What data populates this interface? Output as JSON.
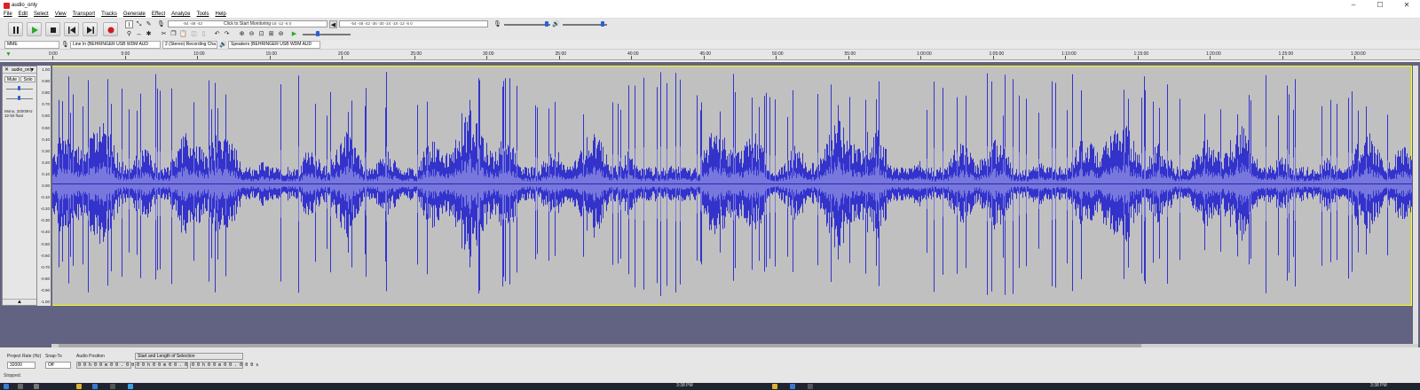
{
  "window": {
    "title": "audio_only"
  },
  "menu": [
    "File",
    "Edit",
    "Select",
    "View",
    "Transport",
    "Tracks",
    "Generate",
    "Effect",
    "Analyze",
    "Tools",
    "Help"
  ],
  "meters": {
    "record_ticks": "-54   -48   -42",
    "monitor_text": "Click to Start Monitoring",
    "record_ticks_right": "-18   -12    -6    0",
    "playback_ticks": "-54   -48   -42   -36   -30   -24   -18   -12    -6    0"
  },
  "devices": {
    "host": "MME",
    "input": "Line In (BEHRINGER USB WDM AUD",
    "channels": "2 (Stereo) Recording Cha",
    "output": "Speakers (BEHRINGER USB WDM AUD"
  },
  "timeline": {
    "ticks": [
      "0:00",
      "5:00",
      "10:00",
      "15:00",
      "20:00",
      "25:00",
      "30:00",
      "35:00",
      "40:00",
      "45:00",
      "50:00",
      "55:00",
      "1:00:00",
      "1:05:00",
      "1:10:00",
      "1:15:00",
      "1:20:00",
      "1:25:00",
      "1:30:00"
    ]
  },
  "track": {
    "name": "audio_only",
    "mute_label": "Mute",
    "solo_label": "Solo",
    "info_line1": "Mono, 32000Hz",
    "info_line2": "32-bit float",
    "collapse_symbol": "▲",
    "waveform_color": "#3333cc",
    "rms_color": "#7777dd",
    "background_color": "#c0c0c0",
    "vruler": [
      "1.00",
      "0.90",
      "0.80",
      "0.70",
      "0.60",
      "0.50",
      "0.40",
      "0.30",
      "0.20",
      "0.10",
      "0.00",
      "-0.10",
      "-0.20",
      "-0.30",
      "-0.40",
      "-0.50",
      "-0.60",
      "-0.70",
      "-0.80",
      "-0.90",
      "-1.00"
    ]
  },
  "selection_bar": {
    "project_rate_label": "Project Rate (Hz)",
    "project_rate": "32000",
    "snap_label": "Snap-To",
    "snap_value": "Off",
    "audio_position_label": "Audio Position",
    "audio_position": "0 0 h 0 0 m 0 0 . 0 0 0 s",
    "selection_mode": "Start and Length of Selection",
    "selection_start": "0 0 h 0 0 m 0 0 . 0 0 0 s",
    "selection_length": "0 0 h 0 0 m 0 0 . 0 0 0 s",
    "status": "Stopped."
  },
  "taskbar": {
    "clock_left": "3:38 PM",
    "clock_right": "3:38 PM"
  }
}
